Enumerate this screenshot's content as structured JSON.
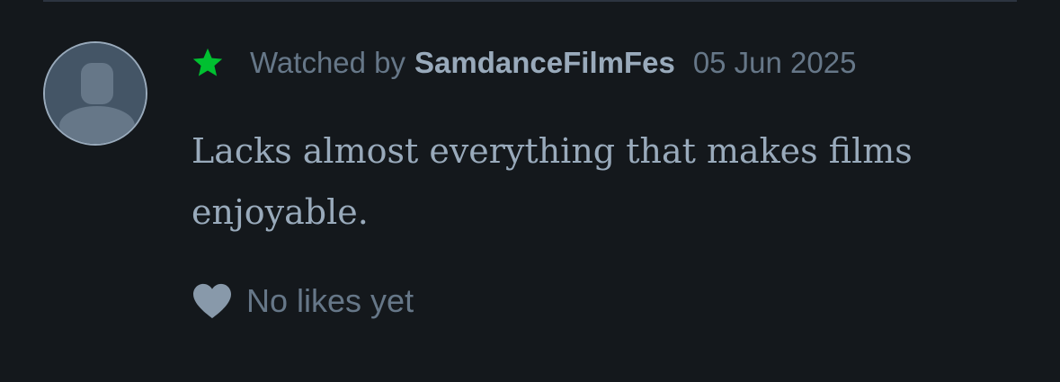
{
  "review": {
    "watched_prefix": "Watched by",
    "username": "SamdanceFilmFes",
    "date": "05 Jun 2025",
    "text": "Lacks almost everything that makes films enjoyable.",
    "likes_label": "No likes yet"
  },
  "colors": {
    "background": "#14181c",
    "star": "#00c030",
    "muted_text": "#667788",
    "username": "#99aabb",
    "review_text": "#99aabb",
    "heart": "#8899aa",
    "avatar_bg": "#445566"
  },
  "icons": {
    "status": "star-icon",
    "like": "heart-icon",
    "avatar": "default-avatar-icon"
  }
}
